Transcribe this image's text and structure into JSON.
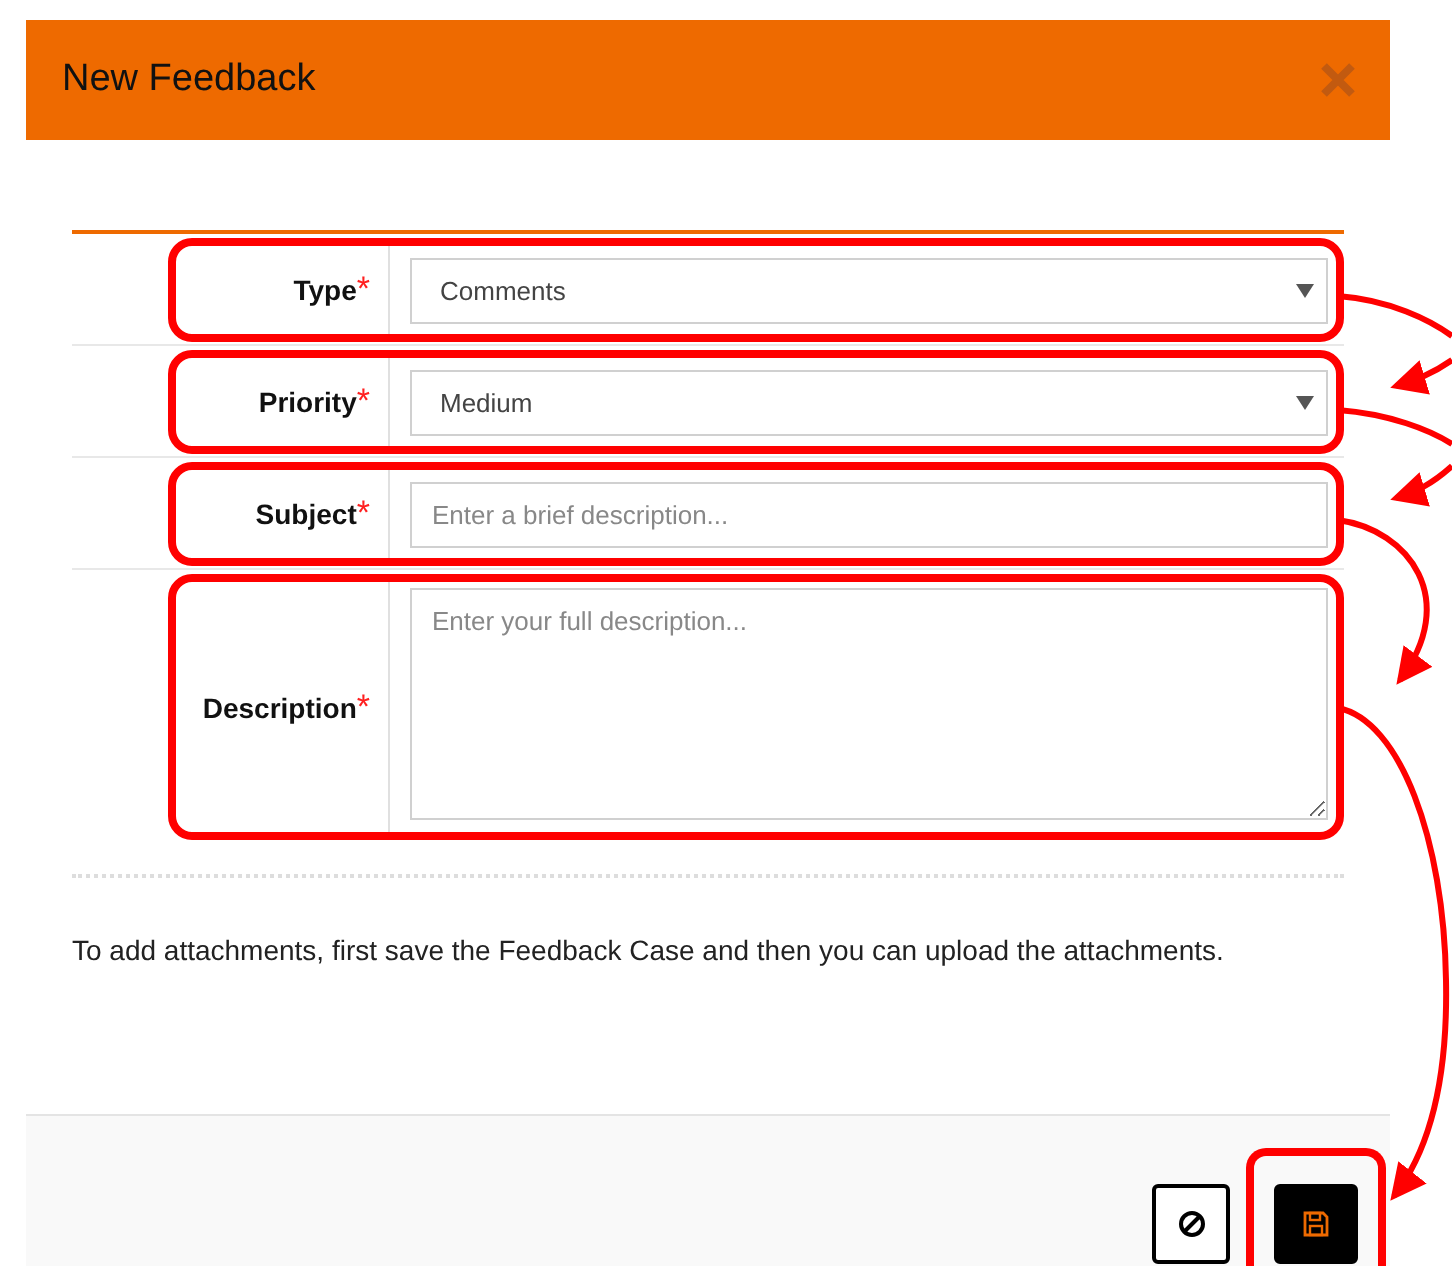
{
  "dialog": {
    "title": "New Feedback"
  },
  "required_mark": "*",
  "fields": [
    {
      "kind": "select",
      "label": "Type",
      "required": true,
      "value": "Comments",
      "highlighted": true
    },
    {
      "kind": "select",
      "label": "Priority",
      "required": true,
      "value": "Medium",
      "highlighted": true
    },
    {
      "kind": "text",
      "label": "Subject",
      "required": true,
      "placeholder": "Enter a brief description...",
      "highlighted": true
    },
    {
      "kind": "textarea",
      "label": "Description",
      "required": true,
      "placeholder": "Enter your full description...",
      "highlighted": true
    }
  ],
  "note": "To add attachments, first save the Feedback Case and then you can upload the attachments.",
  "footer": {
    "buttons": [
      {
        "kind": "cancel",
        "highlighted": false
      },
      {
        "kind": "save",
        "highlighted": true
      }
    ]
  },
  "annotation_arrows": true
}
